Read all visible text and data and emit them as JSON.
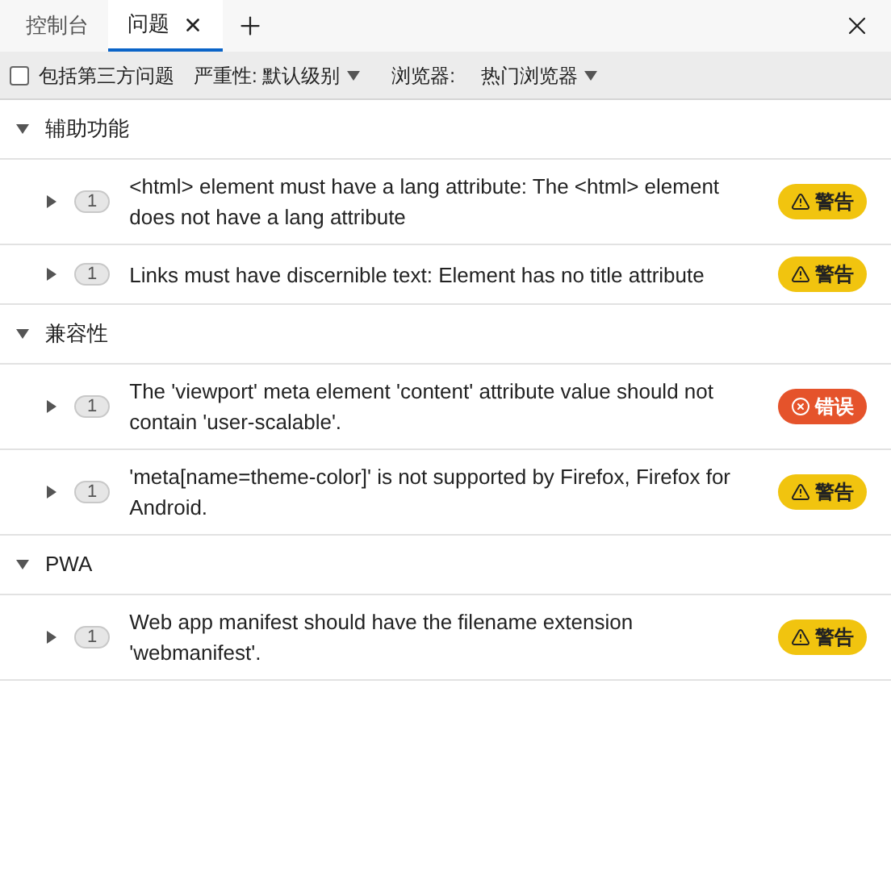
{
  "tabs": [
    {
      "label": "控制台",
      "selected": false
    },
    {
      "label": "问题",
      "selected": true
    }
  ],
  "toolbar": {
    "third_party": {
      "label": "包括第三方问题",
      "checked": false
    },
    "severity": {
      "label": "严重性: 默认级别"
    },
    "browsers": {
      "label": "浏览器:",
      "value": "热门浏览器"
    }
  },
  "groups": [
    {
      "title": "辅助功能",
      "expanded": true,
      "issues": [
        {
          "count": "1",
          "message": "<html> element must have a lang attribute: The <html> element does not have a lang attribute",
          "kind": "warning",
          "severity": "警告"
        },
        {
          "count": "1",
          "message": "Links must have discernible text: Element has no title attribute",
          "kind": "warning",
          "severity": "警告"
        }
      ]
    },
    {
      "title": "兼容性",
      "expanded": true,
      "issues": [
        {
          "count": "1",
          "message": "The 'viewport' meta element 'content' attribute value should not contain 'user-scalable'.",
          "kind": "error",
          "severity": "错误"
        },
        {
          "count": "1",
          "message": "'meta[name=theme-color]' is not supported by Firefox, Firefox for Android.",
          "kind": "warning",
          "severity": "警告"
        }
      ]
    },
    {
      "title": "PWA",
      "expanded": true,
      "issues": [
        {
          "count": "1",
          "message": "Web app manifest should have the filename extension 'webmanifest'.",
          "kind": "warning",
          "severity": "警告"
        }
      ]
    }
  ]
}
